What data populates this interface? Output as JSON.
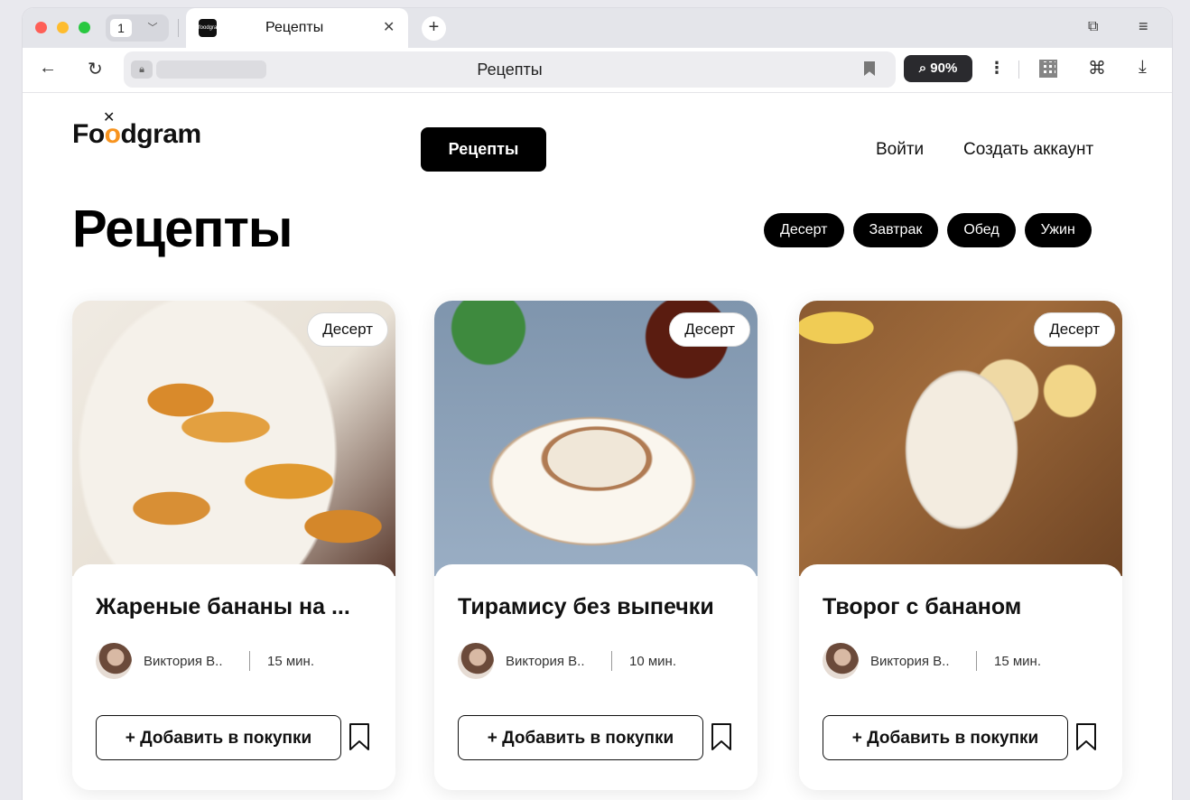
{
  "browser": {
    "tab_count": "1",
    "tab_title": "Рецепты",
    "favicon_text": "foodgram",
    "address_title": "Рецепты",
    "zoom": "⌕ 90%"
  },
  "header": {
    "logo_prefix": "Fo",
    "logo_o": "o",
    "logo_suffix": "dgram",
    "nav_recipes": "Рецепты",
    "login": "Войти",
    "signup": "Создать аккаунт"
  },
  "main": {
    "title": "Рецепты",
    "filters": [
      "Десерт",
      "Завтрак",
      "Обед",
      "Ужин"
    ]
  },
  "cards": [
    {
      "badge": "Десерт",
      "title": "Жареные бананы на ...",
      "author": "Виктория В..",
      "time": "15 мин.",
      "add_label": "+ Добавить в покупки"
    },
    {
      "badge": "Десерт",
      "title": "Тирамису без выпечки",
      "author": "Виктория В..",
      "time": "10 мин.",
      "add_label": "+ Добавить в покупки"
    },
    {
      "badge": "Десерт",
      "title": "Творог с бананом",
      "author": "Виктория В..",
      "time": "15 мин.",
      "add_label": "+ Добавить в покупки"
    }
  ],
  "colors": {
    "accent": "#000000",
    "logo_orange": "#f7931e"
  }
}
